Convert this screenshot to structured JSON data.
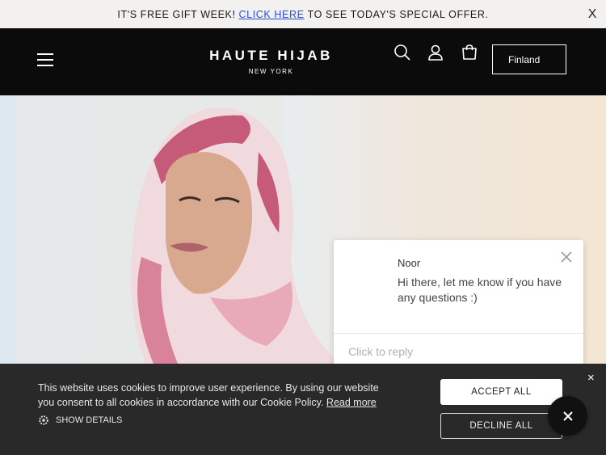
{
  "announcement": {
    "prefix": "IT'S FREE GIFT WEEK!",
    "link": "CLICK HERE",
    "suffix": "TO SEE TODAY'S SPECIAL OFFER.",
    "close": "X"
  },
  "header": {
    "logo_main": "HAUTE HIJAB",
    "logo_sub": "NEW YORK",
    "country": "Finland",
    "icons": [
      "menu-icon",
      "search-icon",
      "account-icon",
      "cart-icon"
    ]
  },
  "chat": {
    "agent": "Noor",
    "message": "Hi there, let me know if you have any questions :)",
    "reply_placeholder": "Click to reply"
  },
  "cookie": {
    "text": "This website uses cookies to improve user experience. By using our website you consent to all cookies in accordance with our Cookie Policy.",
    "read_more": "Read more",
    "show_details": "SHOW DETAILS",
    "accept": "ACCEPT ALL",
    "decline": "DECLINE ALL",
    "close": "×"
  },
  "colors": {
    "announcement_bg": "#f3f1ef",
    "link": "#2a4fd6",
    "header_bg": "#0b0b0b",
    "cookie_bg": "#292929"
  }
}
